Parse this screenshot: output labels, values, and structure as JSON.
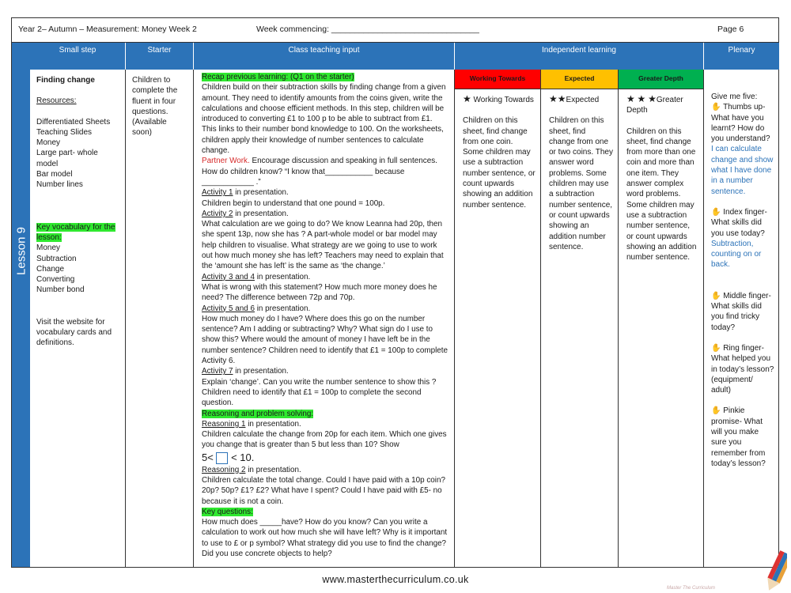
{
  "header": {
    "title": "Year 2– Autumn – Measurement: Money  Week 2",
    "week": "Week commencing: ________________________________",
    "page": "Page 6"
  },
  "lesson_label": "Lesson 9",
  "columns": {
    "small_step": "Small step",
    "starter": "Starter",
    "class_teaching": "Class teaching input",
    "independent": "Independent learning",
    "plenary": "Plenary"
  },
  "small_step": {
    "title": "Finding change",
    "resources_label": "Resources:",
    "resources": [
      "Differentiated Sheets",
      "Teaching Slides",
      "Money",
      "Large part- whole",
      "model",
      "Bar model",
      "Number lines"
    ],
    "key_vocab_label": "Key vocabulary for the lesson:",
    "vocab": [
      "Money",
      "Subtraction",
      "Change",
      "Converting",
      "Number bond"
    ],
    "visit": "Visit the website for vocabulary cards and definitions."
  },
  "starter": {
    "text": "Children to complete the fluent in four questions. (Available soon)"
  },
  "teaching": {
    "recap": "Recap previous learning: (Q1 on the starter)",
    "p1": "Children build on their subtraction skills by finding change from a given amount. They need to identify amounts from the coins given, write the calculations and choose efficient methods. In this step, children will be introduced to converting £1 to 100 p to be able to subtract from £1. This links to their number bond knowledge to 100. On the worksheets, children apply their knowledge of number sentences to calculate change.",
    "partner": "Partner Work.",
    "partner_rest": "  Encourage discussion and speaking in full sentences. How do children know?  “I know that___________ because ____________ .”",
    "a1": "Activity 1",
    "a1_rest": " in presentation.",
    "a1_text": "Children begin to understand that one pound = 100p.",
    "a2": "Activity 2",
    "a2_rest": " in presentation.",
    "a2_text": "What calculation are we going to do? We know Leanna had 20p, then she spent 13p, now she has ? A part-whole model or bar model may help children to visualise. What strategy are we going to use to work out how much money she has left? Teachers may need to explain that the ‘amount she has left’ is the same as ‘the change.’",
    "a34": "Activity 3 and 4",
    "a34_rest": " in presentation.",
    "a34_text": "What is wrong with this statement? How much more money does he need? The difference between 72p and 70p.",
    "a56": "Activity 5 and 6",
    "a56_rest": " in presentation.",
    "a56_text": "How much money do I have? Where does this go on the number sentence? Am I adding or subtracting? Why?  What sign do I use to show this? Where would the amount of money I have left be in the number sentence? Children need to identify that £1 = 100p to complete Activity 6.",
    "a7": "Activity 7",
    "a7_rest": " in presentation.",
    "a7_text": "Explain ‘change’. Can you write the number sentence to show this ? Children need to identify that £1 = 100p to complete the second question.",
    "reasoning": "Reasoning and problem solving:",
    "r1": "Reasoning 1",
    "r1_rest": " in presentation.",
    "r1_text": "Children calculate the change from 20p for each item. Which one gives you change that is greater than 5 but less than 10? Show",
    "ineq_left": "5<",
    "ineq_right": "< 10.",
    "r2": "Reasoning 2",
    "r2_rest": " in presentation.",
    "r2_text": "Children calculate the  total change. Could I have paid with a 10p coin? 20p? 50p? £1? £2? What have I spent? Could I have paid with £5- no because it is not a coin.",
    "keyq": "Key questions:",
    "keyq_text": "How much does _____have? How do you know? Can you write a calculation to work out how much she will have left? Why is it important to use to £ or p symbol? What strategy did you use to find the change? Did you use concrete objects to help?"
  },
  "independent": {
    "wt": {
      "header": "Working Towards",
      "title": "Working Towards",
      "text": "Children on this sheet, find change from one coin. Some children may use a subtraction number sentence, or count upwards showing an addition number sentence.",
      "color": "#ff0000"
    },
    "exp": {
      "header": "Expected",
      "title": "Expected",
      "text": "Children on this sheet, find change from one or two coins. They answer word problems. Some children may use a subtraction number sentence, or count upwards showing an addition number sentence.",
      "color": "#ffc000"
    },
    "gd": {
      "header": "Greater Depth",
      "title": "Greater Depth",
      "text": "Children on this sheet, find change from more than one coin and more than one item. They answer complex word problems. Some children may use a subtraction number sentence, or count upwards showing an addition number sentence.",
      "color": "#00b050"
    }
  },
  "plenary": {
    "intro": "Give me five:",
    "thumb": "Thumbs up- What have you learnt? How do you understand?",
    "thumb_ans": "I can calculate change and show what I have done in a number sentence.",
    "index": "Index finger- What skills did you use today?",
    "index_ans": "Subtraction, counting on or back.",
    "middle": "Middle finger- What skills did you find tricky today?",
    "ring": "Ring finger- What helped you in today’s lesson? (equipment/ adult)",
    "pinkie": "Pinkie promise- What will you make sure you remember from today’s lesson?"
  },
  "footer": {
    "url": "www.masterthecurriculum.co.uk",
    "brand": "Master The Curriculum"
  }
}
